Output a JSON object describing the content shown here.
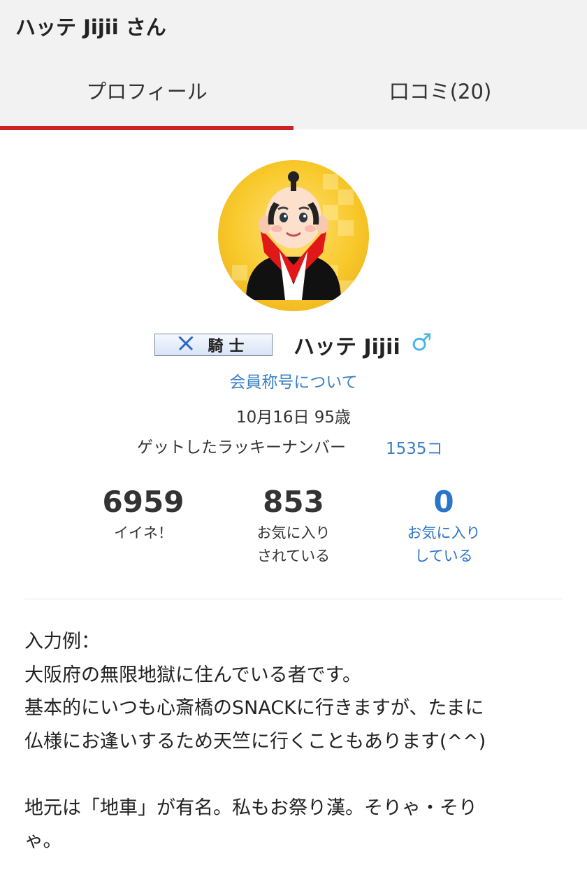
{
  "header": {
    "title": "ハッテ Jijii さん"
  },
  "tabs": [
    {
      "label": "プロフィール",
      "active": true
    },
    {
      "label": "口コミ(20)",
      "active": false
    }
  ],
  "colors": {
    "accent": "#cc2222",
    "link": "#3a7fc4",
    "gender": "#4bb6e6"
  },
  "profile": {
    "rank_label": "騎士",
    "rank_icon": "crossed-axes-icon",
    "name": "ハッテ Jijii",
    "gender_icon": "male-icon",
    "rank_link": "会員称号について",
    "birthday": "10月16日 95歳",
    "lucky_label": "ゲットしたラッキーナンバー",
    "lucky_value": "1535コ"
  },
  "stats": [
    {
      "value": "6959",
      "label": "イイネ！"
    },
    {
      "value": "853",
      "label": "お気に入り\nされている"
    },
    {
      "value": "0",
      "label": "お気に入り\nしている"
    }
  ],
  "bio": "入力例：\n大阪府の無限地獄に住んでいる者です。\n基本的にいつも心斎橋のSNACKに行きますが、たまに\n仏様にお逢いするため天竺に行くこともあります(^^)\n\n地元は「地車」が有名。私もお祭り漢。そりゃ・そり\nゃ。"
}
